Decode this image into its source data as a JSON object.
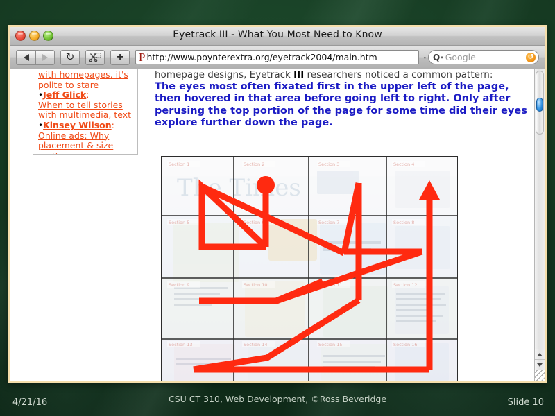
{
  "slide": {
    "date": "4/21/16",
    "center_credit": "CSU CT 310, Web Development, ©Ross Beveridge",
    "slide_number": "Slide 10"
  },
  "browser": {
    "title": "Eyetrack III - What You Most Need to Know",
    "window_controls": [
      {
        "name": "close",
        "color": "#e8493a"
      },
      {
        "name": "minimize",
        "color": "#f5ab25"
      },
      {
        "name": "zoom",
        "color": "#6fc030"
      }
    ],
    "toolbar": {
      "back_label": "◀",
      "forward_label": "▶",
      "reload_label": "↻",
      "snippet_label": "✂",
      "add_label": "+",
      "url_logo": "P",
      "url_value": "http://www.poynterextra.org/eyetrack2004/main.htm",
      "url_dropdown": "▪",
      "search_icon": "Q",
      "search_caret": "▾",
      "search_placeholder": "Google",
      "search_go": "↺"
    },
    "scrollbar": {
      "up_arrow": "▲",
      "down_arrow": "▼"
    }
  },
  "page": {
    "sidebar": {
      "items": [
        {
          "prefix": "",
          "author": "",
          "link": "with homepages, it's polite to stare"
        },
        {
          "prefix": "•",
          "author": "Jeff Glick",
          "link": "When to tell stories with multimedia, text"
        },
        {
          "prefix": "•",
          "author": "Kinsey Wilson",
          "link": "Online ads: Why placement & size matter"
        }
      ]
    },
    "article": {
      "intro_before": "homepage designs, Eyetrack ",
      "intro_bold": "III",
      "intro_after": " researchers noticed a common pattern:",
      "highlight": "The eyes most often fixated first in the upper left of the page, then hovered in that area before going left to right. Only after perusing the top portion of the page for some time did their eyes explore further down the page."
    },
    "figure": {
      "name": "eyetrack-scanpath-diagram",
      "description": "Newspaper homepage thumbnail divided by a 4-column by 5-row grid with a red eye-movement scanpath drawn over it",
      "grid": {
        "columns": 4,
        "rows": 5,
        "line_color": "#2c2c2c"
      },
      "scanpath": {
        "color": "#ff2a10",
        "stroke_width": 9,
        "start_marker": "filled-circle",
        "end_marker": "arrowhead-up"
      }
    }
  },
  "colors": {
    "slide_background": "#16381f",
    "window_border": "#f5deab",
    "link": "#f04a16",
    "highlight_text": "#1b1bc4",
    "scanpath_red": "#ff2a10"
  }
}
